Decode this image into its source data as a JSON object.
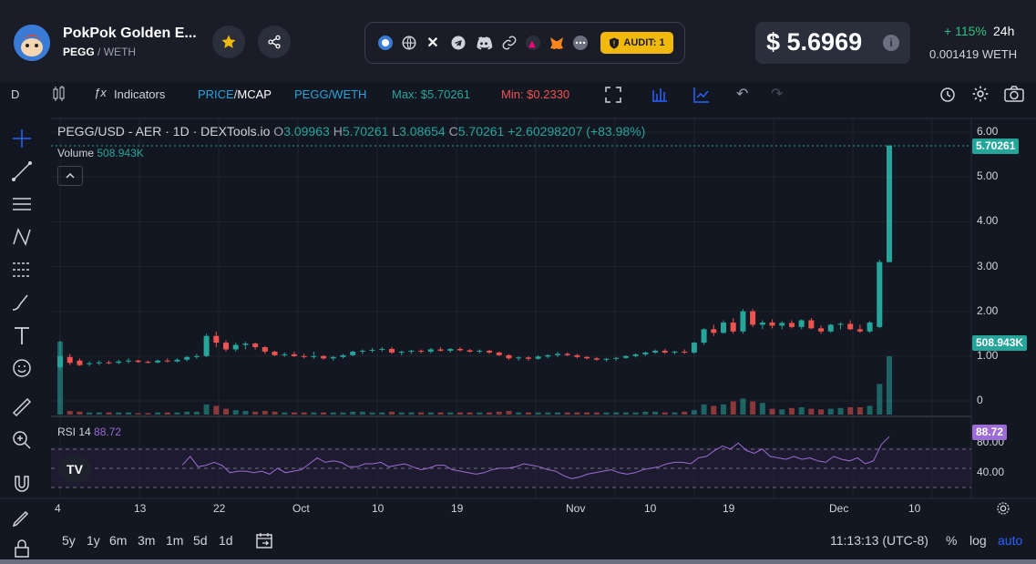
{
  "header": {
    "token_name": "PokPok Golden E...",
    "token_symbol": "PEGG",
    "pair_separator": "/",
    "quote_symbol": "WETH",
    "audit_label": "AUDIT: 1",
    "price": "$ 5.6969",
    "change": "+ 115%",
    "change_period": "24h",
    "eth_price": "0.001419",
    "eth_symbol": "WETH",
    "link_icons": [
      "explorer-icon",
      "globe-icon",
      "x-icon",
      "telegram-icon",
      "discord-icon",
      "link-icon",
      "uniswap-icon",
      "metamask-icon",
      "more-icon"
    ]
  },
  "toolbar": {
    "interval": "D",
    "indicators": "Indicators",
    "price_label": "PRICE",
    "mcap_label": "MCAP",
    "pair_toggle": "PEGG/WETH",
    "max_label": "Max: $5.70261",
    "min_label": "Min: $0.2330"
  },
  "legend": {
    "symbol": "PEGG/USD - AER · 1D · DEXTools.io",
    "o_key": "O",
    "o_val": "3.09963",
    "h_key": "H",
    "h_val": "5.70261",
    "l_key": "L",
    "l_val": "3.08654",
    "c_key": "C",
    "c_val": "5.70261",
    "change": "+2.60298207 (+83.98%)",
    "volume_label": "Volume",
    "volume_val": "508.943K",
    "rsi_label": "RSI 14",
    "rsi_val": "88.72"
  },
  "price_axis": [
    "6.00",
    "5.00",
    "4.00",
    "3.00",
    "2.00",
    "1.00",
    "0"
  ],
  "price_tag": "5.70261",
  "volume_tag": "508.943K",
  "rsi_axis": [
    "80.00",
    "40.00"
  ],
  "rsi_tag": "88.72",
  "time_axis": [
    "4",
    "13",
    "22",
    "Oct",
    "10",
    "19",
    "Nov",
    "10",
    "19",
    "Dec",
    "10"
  ],
  "bottom": {
    "ranges": [
      "5y",
      "1y",
      "6m",
      "3m",
      "1m",
      "5d",
      "1d"
    ],
    "time": "11:13:13 (UTC-8)",
    "percent": "%",
    "log": "log",
    "auto": "auto"
  },
  "colors": {
    "up": "#26a69a",
    "down": "#ef5350",
    "rsi": "#9c6bd4",
    "accent_blue": "#2962ff",
    "audit": "#f0b90b"
  },
  "chart_data": {
    "type": "candlestick",
    "ylim": [
      0,
      6
    ],
    "candles": [
      {
        "o": 0.75,
        "h": 1.35,
        "l": 0.7,
        "c": 1.0
      },
      {
        "o": 0.98,
        "h": 1.05,
        "l": 0.8,
        "c": 0.85
      },
      {
        "o": 0.9,
        "h": 0.95,
        "l": 0.78,
        "c": 0.8
      },
      {
        "o": 0.82,
        "h": 0.88,
        "l": 0.78,
        "c": 0.84
      },
      {
        "o": 0.84,
        "h": 0.9,
        "l": 0.8,
        "c": 0.86
      },
      {
        "o": 0.86,
        "h": 0.9,
        "l": 0.82,
        "c": 0.85
      },
      {
        "o": 0.85,
        "h": 0.92,
        "l": 0.82,
        "c": 0.88
      },
      {
        "o": 0.88,
        "h": 0.95,
        "l": 0.84,
        "c": 0.9
      },
      {
        "o": 0.9,
        "h": 0.92,
        "l": 0.85,
        "c": 0.87
      },
      {
        "o": 0.87,
        "h": 0.9,
        "l": 0.84,
        "c": 0.86
      },
      {
        "o": 0.86,
        "h": 0.92,
        "l": 0.84,
        "c": 0.9
      },
      {
        "o": 0.9,
        "h": 0.95,
        "l": 0.86,
        "c": 0.88
      },
      {
        "o": 0.88,
        "h": 0.95,
        "l": 0.86,
        "c": 0.92
      },
      {
        "o": 0.92,
        "h": 1.0,
        "l": 0.88,
        "c": 0.98
      },
      {
        "o": 0.98,
        "h": 1.05,
        "l": 0.94,
        "c": 1.0
      },
      {
        "o": 1.0,
        "h": 1.5,
        "l": 0.98,
        "c": 1.45
      },
      {
        "o": 1.45,
        "h": 1.55,
        "l": 1.2,
        "c": 1.3
      },
      {
        "o": 1.3,
        "h": 1.35,
        "l": 1.1,
        "c": 1.15
      },
      {
        "o": 1.15,
        "h": 1.3,
        "l": 1.1,
        "c": 1.25
      },
      {
        "o": 1.25,
        "h": 1.32,
        "l": 1.15,
        "c": 1.28
      },
      {
        "o": 1.28,
        "h": 1.3,
        "l": 1.15,
        "c": 1.2
      },
      {
        "o": 1.2,
        "h": 1.22,
        "l": 1.05,
        "c": 1.1
      },
      {
        "o": 1.1,
        "h": 1.12,
        "l": 1.0,
        "c": 1.02
      },
      {
        "o": 1.02,
        "h": 1.08,
        "l": 0.98,
        "c": 1.04
      },
      {
        "o": 1.04,
        "h": 1.1,
        "l": 0.98,
        "c": 1.0
      },
      {
        "o": 1.0,
        "h": 1.05,
        "l": 0.95,
        "c": 0.98
      },
      {
        "o": 0.98,
        "h": 1.1,
        "l": 0.94,
        "c": 1.0
      },
      {
        "o": 1.0,
        "h": 1.02,
        "l": 0.92,
        "c": 0.95
      },
      {
        "o": 0.95,
        "h": 1.0,
        "l": 0.9,
        "c": 0.98
      },
      {
        "o": 0.98,
        "h": 1.05,
        "l": 0.95,
        "c": 1.02
      },
      {
        "o": 1.02,
        "h": 1.12,
        "l": 1.0,
        "c": 1.1
      },
      {
        "o": 1.1,
        "h": 1.15,
        "l": 1.05,
        "c": 1.12
      },
      {
        "o": 1.12,
        "h": 1.18,
        "l": 1.08,
        "c": 1.14
      },
      {
        "o": 1.14,
        "h": 1.2,
        "l": 1.1,
        "c": 1.16
      },
      {
        "o": 1.16,
        "h": 1.2,
        "l": 1.05,
        "c": 1.08
      },
      {
        "o": 1.08,
        "h": 1.12,
        "l": 1.02,
        "c": 1.1
      },
      {
        "o": 1.1,
        "h": 1.14,
        "l": 1.05,
        "c": 1.12
      },
      {
        "o": 1.12,
        "h": 1.15,
        "l": 1.06,
        "c": 1.1
      },
      {
        "o": 1.1,
        "h": 1.18,
        "l": 1.06,
        "c": 1.15
      },
      {
        "o": 1.15,
        "h": 1.2,
        "l": 1.1,
        "c": 1.12
      },
      {
        "o": 1.12,
        "h": 1.18,
        "l": 1.08,
        "c": 1.16
      },
      {
        "o": 1.16,
        "h": 1.2,
        "l": 1.1,
        "c": 1.13
      },
      {
        "o": 1.13,
        "h": 1.16,
        "l": 1.08,
        "c": 1.1
      },
      {
        "o": 1.1,
        "h": 1.15,
        "l": 1.06,
        "c": 1.12
      },
      {
        "o": 1.12,
        "h": 1.14,
        "l": 1.05,
        "c": 1.08
      },
      {
        "o": 1.08,
        "h": 1.1,
        "l": 1.0,
        "c": 1.02
      },
      {
        "o": 1.02,
        "h": 1.04,
        "l": 0.92,
        "c": 0.95
      },
      {
        "o": 0.95,
        "h": 1.0,
        "l": 0.9,
        "c": 0.97
      },
      {
        "o": 0.97,
        "h": 1.0,
        "l": 0.9,
        "c": 0.94
      },
      {
        "o": 0.94,
        "h": 1.02,
        "l": 0.92,
        "c": 0.99
      },
      {
        "o": 0.99,
        "h": 1.04,
        "l": 0.95,
        "c": 1.02
      },
      {
        "o": 1.02,
        "h": 1.1,
        "l": 0.98,
        "c": 1.05
      },
      {
        "o": 1.05,
        "h": 1.08,
        "l": 1.0,
        "c": 1.02
      },
      {
        "o": 1.02,
        "h": 1.05,
        "l": 0.95,
        "c": 0.98
      },
      {
        "o": 0.98,
        "h": 1.0,
        "l": 0.93,
        "c": 0.95
      },
      {
        "o": 0.95,
        "h": 0.98,
        "l": 0.9,
        "c": 0.92
      },
      {
        "o": 0.92,
        "h": 0.96,
        "l": 0.88,
        "c": 0.94
      },
      {
        "o": 0.94,
        "h": 0.98,
        "l": 0.9,
        "c": 0.96
      },
      {
        "o": 0.96,
        "h": 1.02,
        "l": 0.94,
        "c": 1.0
      },
      {
        "o": 1.0,
        "h": 1.06,
        "l": 0.97,
        "c": 1.04
      },
      {
        "o": 1.04,
        "h": 1.1,
        "l": 1.0,
        "c": 1.08
      },
      {
        "o": 1.08,
        "h": 1.15,
        "l": 1.05,
        "c": 1.12
      },
      {
        "o": 1.12,
        "h": 1.16,
        "l": 1.05,
        "c": 1.08
      },
      {
        "o": 1.08,
        "h": 1.12,
        "l": 1.04,
        "c": 1.1
      },
      {
        "o": 1.1,
        "h": 1.15,
        "l": 1.05,
        "c": 1.08
      },
      {
        "o": 1.08,
        "h": 1.32,
        "l": 1.05,
        "c": 1.3
      },
      {
        "o": 1.3,
        "h": 1.62,
        "l": 1.25,
        "c": 1.6
      },
      {
        "o": 1.6,
        "h": 1.7,
        "l": 1.45,
        "c": 1.52
      },
      {
        "o": 1.52,
        "h": 1.8,
        "l": 1.5,
        "c": 1.75
      },
      {
        "o": 1.75,
        "h": 1.85,
        "l": 1.5,
        "c": 1.55
      },
      {
        "o": 1.55,
        "h": 2.05,
        "l": 1.5,
        "c": 2.0
      },
      {
        "o": 2.0,
        "h": 2.05,
        "l": 1.65,
        "c": 1.7
      },
      {
        "o": 1.7,
        "h": 1.8,
        "l": 1.6,
        "c": 1.75
      },
      {
        "o": 1.75,
        "h": 1.82,
        "l": 1.62,
        "c": 1.68
      },
      {
        "o": 1.68,
        "h": 1.78,
        "l": 1.6,
        "c": 1.74
      },
      {
        "o": 1.74,
        "h": 1.8,
        "l": 1.62,
        "c": 1.65
      },
      {
        "o": 1.65,
        "h": 1.82,
        "l": 1.6,
        "c": 1.8
      },
      {
        "o": 1.8,
        "h": 1.85,
        "l": 1.6,
        "c": 1.62
      },
      {
        "o": 1.62,
        "h": 1.68,
        "l": 1.5,
        "c": 1.55
      },
      {
        "o": 1.55,
        "h": 1.72,
        "l": 1.52,
        "c": 1.7
      },
      {
        "o": 1.7,
        "h": 1.75,
        "l": 1.6,
        "c": 1.72
      },
      {
        "o": 1.72,
        "h": 1.8,
        "l": 1.58,
        "c": 1.6
      },
      {
        "o": 1.6,
        "h": 1.7,
        "l": 1.52,
        "c": 1.55
      },
      {
        "o": 1.55,
        "h": 1.78,
        "l": 1.52,
        "c": 1.75
      },
      {
        "o": 1.65,
        "h": 3.15,
        "l": 1.62,
        "c": 3.1
      },
      {
        "o": 3.09963,
        "h": 5.70261,
        "l": 3.08654,
        "c": 5.70261
      }
    ],
    "volume": [
      1.0,
      0.05,
      0.04,
      0.03,
      0.03,
      0.03,
      0.03,
      0.03,
      0.02,
      0.02,
      0.03,
      0.03,
      0.03,
      0.04,
      0.04,
      0.14,
      0.12,
      0.08,
      0.06,
      0.05,
      0.04,
      0.05,
      0.04,
      0.03,
      0.03,
      0.03,
      0.03,
      0.03,
      0.03,
      0.03,
      0.04,
      0.04,
      0.03,
      0.03,
      0.04,
      0.03,
      0.03,
      0.03,
      0.03,
      0.03,
      0.03,
      0.03,
      0.03,
      0.03,
      0.03,
      0.04,
      0.05,
      0.03,
      0.03,
      0.03,
      0.03,
      0.03,
      0.03,
      0.03,
      0.03,
      0.03,
      0.03,
      0.03,
      0.03,
      0.03,
      0.04,
      0.04,
      0.03,
      0.03,
      0.04,
      0.06,
      0.14,
      0.12,
      0.14,
      0.18,
      0.22,
      0.18,
      0.16,
      0.08,
      0.07,
      0.09,
      0.1,
      0.08,
      0.07,
      0.08,
      0.09,
      0.1,
      0.1,
      0.12,
      0.42,
      0.8
    ],
    "volume_max": "508.943K",
    "rsi": [
      50,
      62,
      48,
      50,
      54,
      50,
      40,
      42,
      42,
      40,
      42,
      38,
      46,
      40,
      42,
      44,
      52,
      60,
      54,
      56,
      54,
      48,
      48,
      52,
      52,
      54,
      48,
      50,
      52,
      48,
      44,
      46,
      50,
      50,
      44,
      42,
      40,
      38,
      40,
      44,
      46,
      46,
      48,
      52,
      50,
      48,
      44,
      42,
      36,
      32,
      34,
      38,
      40,
      42,
      44,
      40,
      38,
      40,
      44,
      46,
      48,
      52,
      54,
      54,
      52,
      60,
      62,
      70,
      76,
      72,
      80,
      70,
      66,
      72,
      62,
      60,
      58,
      62,
      58,
      60,
      56,
      54,
      62,
      58,
      56,
      60,
      52,
      56,
      78,
      88.72
    ],
    "rsi_levels": [
      80,
      40
    ]
  }
}
